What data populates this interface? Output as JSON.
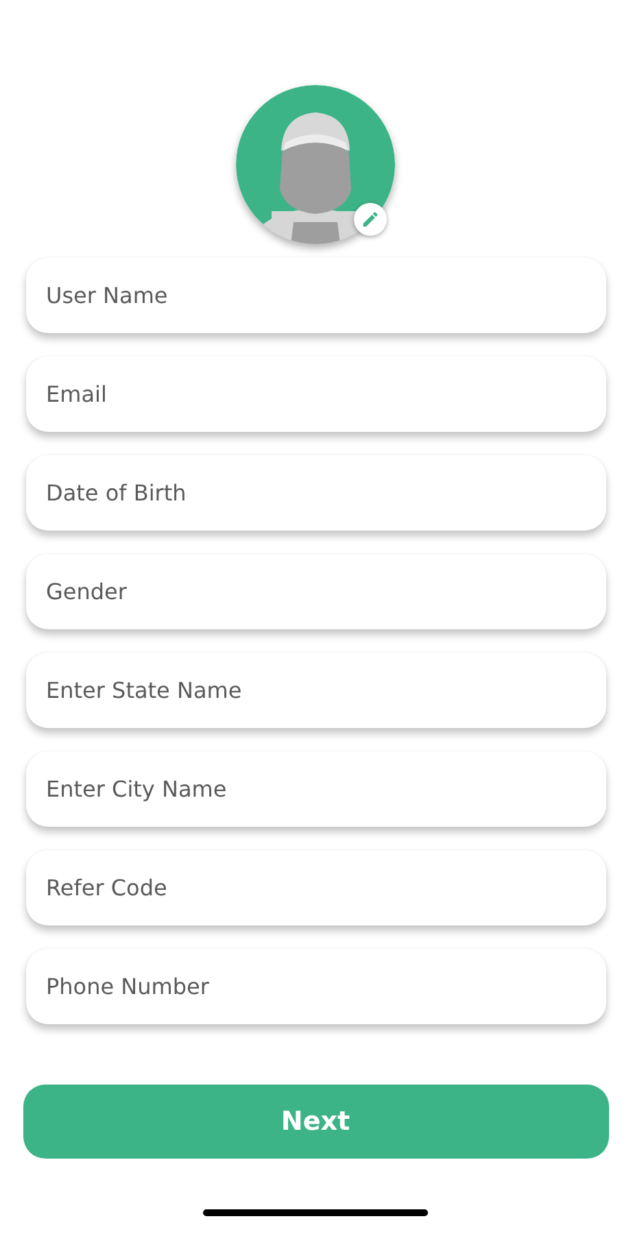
{
  "fields": [
    {
      "placeholder": "User Name"
    },
    {
      "placeholder": "Email"
    },
    {
      "placeholder": "Date of Birth"
    },
    {
      "placeholder": "Gender"
    },
    {
      "placeholder": "Enter State Name"
    },
    {
      "placeholder": "Enter City Name"
    },
    {
      "placeholder": "Refer Code"
    },
    {
      "placeholder": "Phone Number"
    }
  ],
  "next_button": {
    "label": "Next"
  }
}
